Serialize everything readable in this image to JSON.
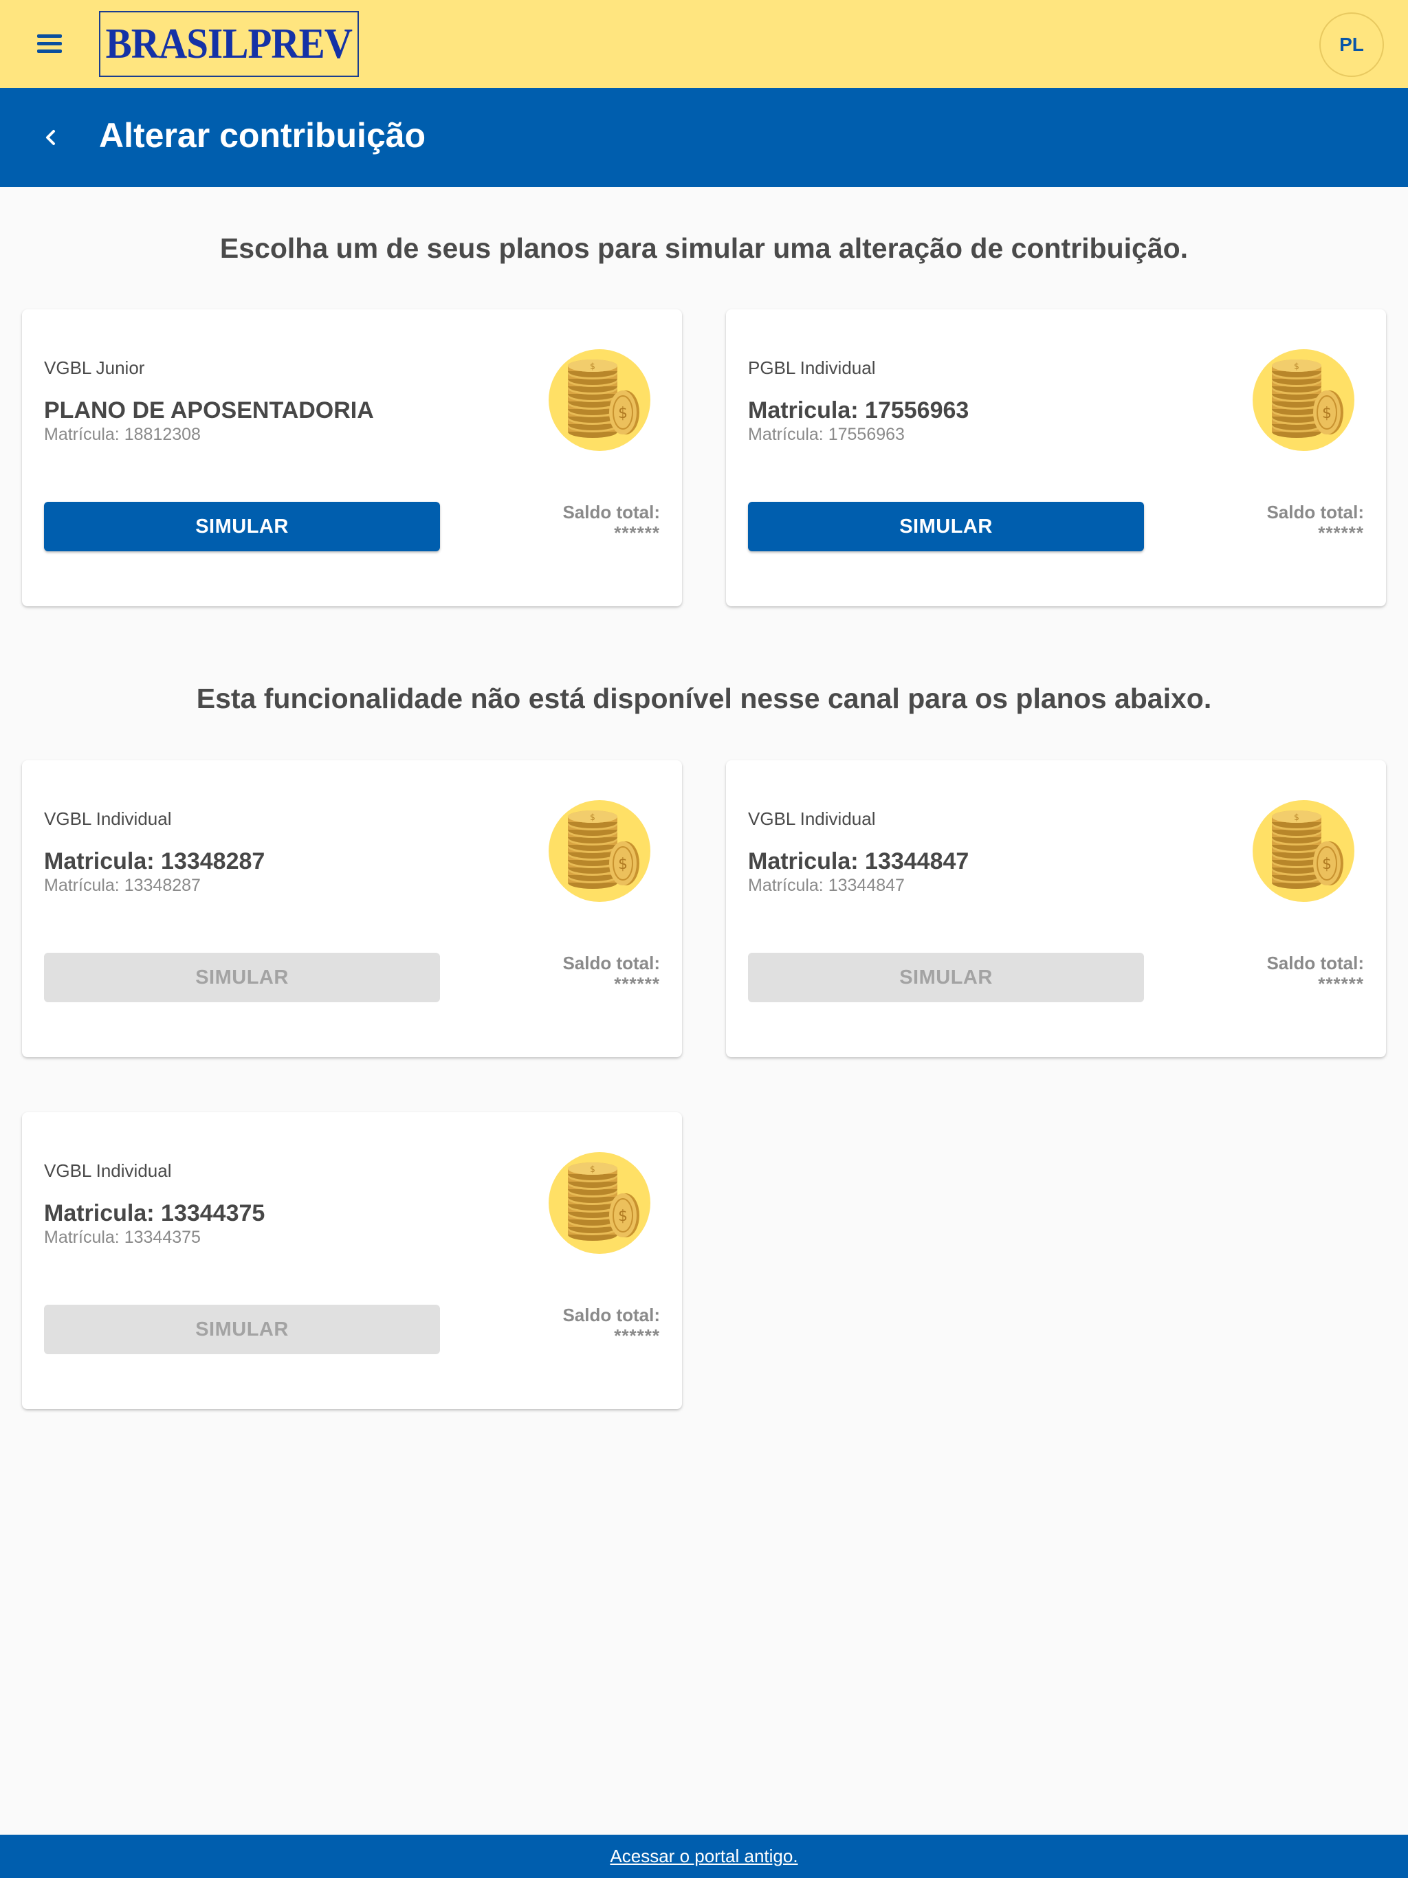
{
  "header": {
    "logo_text": "BRASILPREV",
    "avatar_initials": "PL",
    "menu_icon": "hamburger-menu-icon"
  },
  "page": {
    "title": "Alterar contribuição",
    "back_icon": "chevron-left-icon"
  },
  "available_section": {
    "heading": "Escolha um de seus planos para simular uma alteração de contribuição.",
    "cards": [
      {
        "plan_type": "VGBL Junior",
        "plan_name": "PLANO DE APOSENTADORIA",
        "registration": "Matrícula: 18812308",
        "button_label": "SIMULAR",
        "saldo_label": "Saldo total:",
        "saldo_value": "******",
        "enabled": true
      },
      {
        "plan_type": "PGBL Individual",
        "plan_name": "Matricula: 17556963",
        "registration": "Matrícula: 17556963",
        "button_label": "SIMULAR",
        "saldo_label": "Saldo total:",
        "saldo_value": "******",
        "enabled": true
      }
    ]
  },
  "unavailable_section": {
    "heading": "Esta funcionalidade não está disponível nesse canal para os planos abaixo.",
    "cards": [
      {
        "plan_type": "VGBL Individual",
        "plan_name": "Matricula: 13348287",
        "registration": "Matrícula: 13348287",
        "button_label": "SIMULAR",
        "saldo_label": "Saldo total:",
        "saldo_value": "******",
        "enabled": false
      },
      {
        "plan_type": "VGBL Individual",
        "plan_name": "Matricula: 13344847",
        "registration": "Matrícula: 13344847",
        "button_label": "SIMULAR",
        "saldo_label": "Saldo total:",
        "saldo_value": "******",
        "enabled": false
      },
      {
        "plan_type": "VGBL Individual",
        "plan_name": "Matricula: 13344375",
        "registration": "Matrícula: 13344375",
        "button_label": "SIMULAR",
        "saldo_label": "Saldo total:",
        "saldo_value": "******",
        "enabled": false
      }
    ]
  },
  "footer": {
    "link_text": "Acessar o portal antigo."
  },
  "colors": {
    "topbar": "#ffe57f",
    "primary_blue": "#005eae",
    "logo_blue": "#1432a6",
    "coin_circle": "#ffe066",
    "disabled_button": "#e0e0e0"
  }
}
